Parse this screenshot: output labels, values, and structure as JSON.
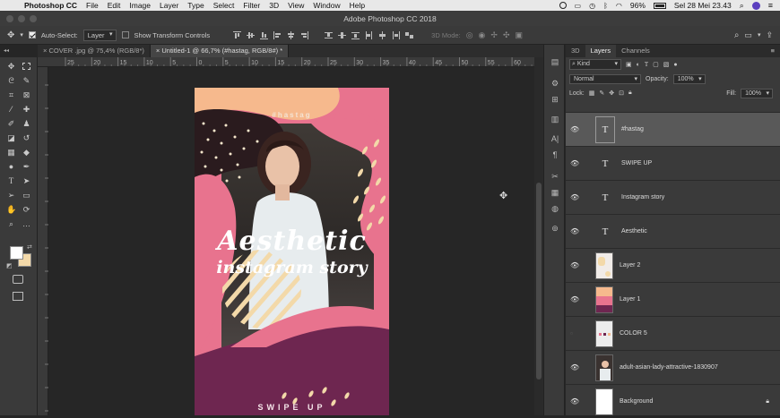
{
  "menubar": {
    "app": "Photoshop CC",
    "items": [
      "File",
      "Edit",
      "Image",
      "Layer",
      "Type",
      "Select",
      "Filter",
      "3D",
      "View",
      "Window",
      "Help"
    ],
    "battery": "96%",
    "datetime": "Sel 28 Mei  23.43"
  },
  "window": {
    "title": "Adobe Photoshop CC 2018"
  },
  "options": {
    "auto_select_label": "Auto-Select:",
    "auto_select_target": "Layer",
    "transform_label": "Show Transform Controls",
    "mode_3d_label": "3D Mode:"
  },
  "tabs": [
    {
      "label": "COVER .jpg @ 75,4% (RGB/8*)"
    },
    {
      "label": "Untitled-1 @ 66,7% (#hastag, RGB/8#) *"
    }
  ],
  "ruler": {
    "ticks": [
      "25",
      "20",
      "15",
      "10",
      "5",
      "0",
      "5",
      "10",
      "15",
      "20",
      "25",
      "30",
      "35",
      "40",
      "45",
      "50",
      "55",
      "60",
      "65"
    ]
  },
  "document": {
    "hashtag": "#hastag",
    "headline1": "Aesthetic",
    "headline2": "instagram story",
    "cta": "SWIPE UP",
    "colors": {
      "peach": "#f6b98d",
      "pink": "#e8738e",
      "plum": "#6e2650",
      "cream": "#f3d9a9",
      "dark": "#2a1b1e"
    }
  },
  "layers_panel": {
    "tabs": [
      "3D",
      "Layers",
      "Channels"
    ],
    "filter_label": "Kind",
    "blend_mode": "Normal",
    "opacity_label": "Opacity:",
    "opacity_value": "100%",
    "lock_label": "Lock:",
    "fill_label": "Fill:",
    "fill_value": "100%",
    "layers": [
      {
        "name": "#hastag",
        "kind": "text",
        "visible": true,
        "selected": true
      },
      {
        "name": "SWIPE UP",
        "kind": "text",
        "visible": true,
        "selected": false
      },
      {
        "name": "Instagram story",
        "kind": "text",
        "visible": true,
        "selected": false
      },
      {
        "name": "Aesthetic",
        "kind": "text",
        "visible": true,
        "selected": false
      },
      {
        "name": "Layer 2",
        "kind": "image",
        "visible": true,
        "selected": false
      },
      {
        "name": "Layer 1",
        "kind": "image",
        "visible": true,
        "selected": false
      },
      {
        "name": "COLOR 5",
        "kind": "image",
        "visible": false,
        "selected": false
      },
      {
        "name": "adult-asian-lady-attractive-1830907",
        "kind": "image",
        "visible": true,
        "selected": false
      },
      {
        "name": "Background",
        "kind": "image",
        "visible": true,
        "selected": false
      }
    ]
  }
}
